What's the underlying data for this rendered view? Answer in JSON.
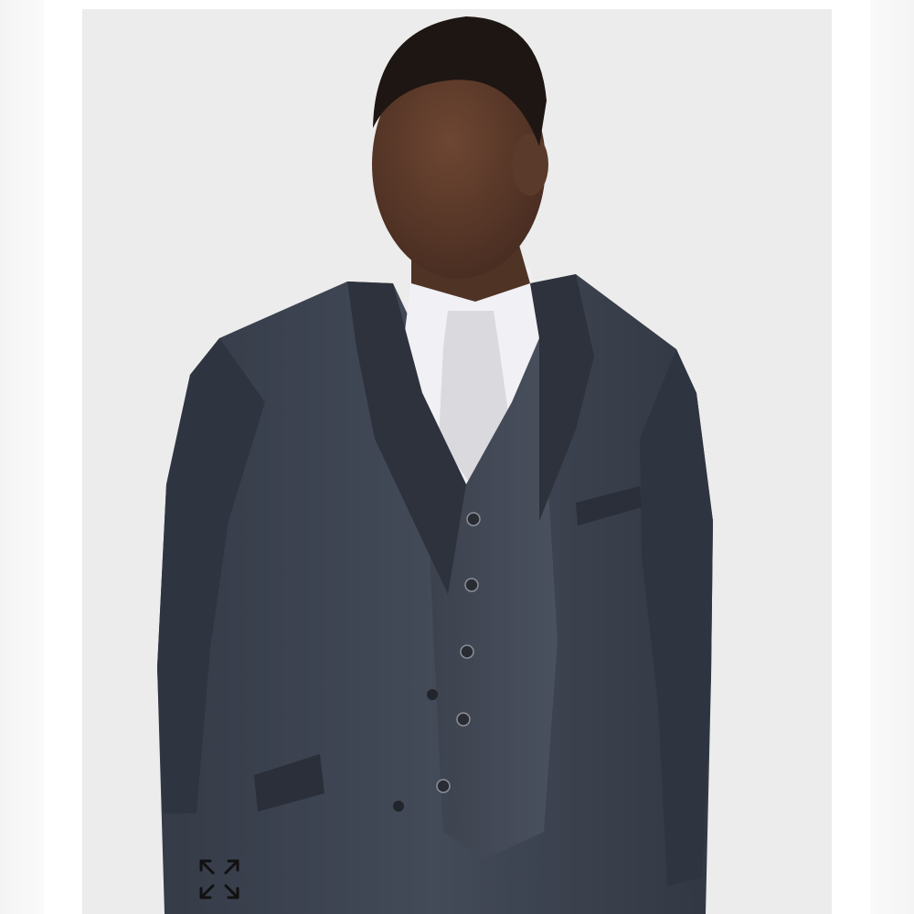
{
  "product_image": {
    "subject": "model-in-charcoal-three-piece-suit",
    "colors": {
      "background": "#ececec",
      "suit": "#3c4350",
      "suit_shadow": "#2b3039",
      "shirt": "#f1f0f4",
      "tie": "#d9d9de",
      "skin": "#5a3a2a",
      "hair": "#1e1612",
      "button": "#2a2c33"
    }
  },
  "wishlist": {
    "icon": "heart-outline-icon",
    "color": "#111111"
  },
  "expand": {
    "icon": "expand-arrows-icon",
    "color": "#111111"
  }
}
